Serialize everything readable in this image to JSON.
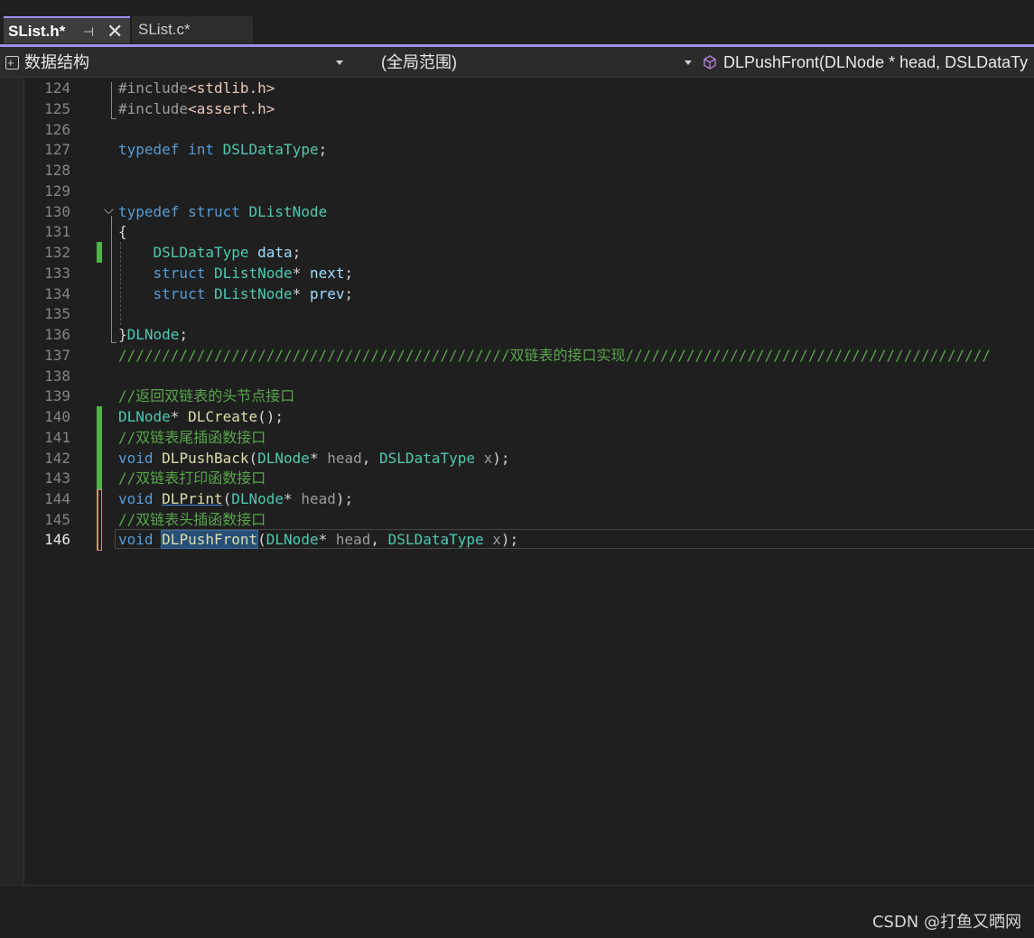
{
  "tabs": {
    "active": "SList.h*",
    "inactive": "SList.c*",
    "pin_glyph": "⊣",
    "close_glyph": "✕"
  },
  "navbar": {
    "project": "数据结构",
    "scope": "(全局范围)",
    "member": "DLPushFront(DLNode * head, DSLDataType x)"
  },
  "colors": {
    "accent": "#9d8ef5",
    "background": "#1f1f1f",
    "keyword": "#569cd6",
    "type": "#4ec9b0",
    "function": "#dcdcaa",
    "comment": "#57a64a",
    "change_saved": "#4fb249",
    "change_unsaved": "#c7a230"
  },
  "editor": {
    "current_line": "146",
    "line_numbers": [
      "124",
      "125",
      "126",
      "127",
      "128",
      "129",
      "130",
      "131",
      "132",
      "133",
      "134",
      "135",
      "136",
      "137",
      "138",
      "139",
      "140",
      "141",
      "142",
      "143",
      "144",
      "145",
      "146"
    ],
    "lines": {
      "l124": {
        "pp": "#include",
        "inc": "<stdlib.h>"
      },
      "l125": {
        "pp": "#include",
        "inc": "<assert.h>"
      },
      "l127": {
        "kw1": "typedef",
        "kw2": "int",
        "ty": "DSLDataType",
        "end": ";"
      },
      "l130": {
        "kw1": "typedef",
        "kw2": "struct",
        "ty": "DListNode"
      },
      "l131": {
        "brace": "{"
      },
      "l132": {
        "ty": "DSLDataType",
        "var": "data",
        "end": ";"
      },
      "l133": {
        "kw": "struct",
        "ty": "DListNode",
        "op": "*",
        "var": "next",
        "end": ";"
      },
      "l134": {
        "kw": "struct",
        "ty": "DListNode",
        "op": "*",
        "var": "prev",
        "end": ";"
      },
      "l136": {
        "brace": "}",
        "ty": "DLNode",
        "end": ";"
      },
      "l137": {
        "cm": "/////////////////////////////////////////////双链表的接口实现//////////////////////////////////////////"
      },
      "l139": {
        "cm": "//返回双链表的头节点接口"
      },
      "l140": {
        "ty": "DLNode",
        "op": "*",
        "fn": "DLCreate",
        "rest": "();"
      },
      "l141": {
        "cm": "//双链表尾插函数接口"
      },
      "l142": {
        "kw": "void",
        "fn": "DLPushBack",
        "open": "(",
        "ty1": "DLNode",
        "op": "*",
        "p1": "head",
        "comma": ",",
        "ty2": "DSLDataType",
        "p2": "x",
        "close": ");"
      },
      "l143": {
        "cm": "//双链表打印函数接口"
      },
      "l144": {
        "kw": "void",
        "fn": "DLPrint",
        "open": "(",
        "ty1": "DLNode",
        "op": "*",
        "p1": "head",
        "close": ");"
      },
      "l145": {
        "cm": "//双链表头插函数接口"
      },
      "l146": {
        "kw": "void",
        "fn": "DLPushFront",
        "open": "(",
        "ty1": "DLNode",
        "op": "*",
        "p1": "head",
        "comma": ",",
        "ty2": "DSLDataType",
        "p2": "x",
        "close": ");"
      }
    },
    "fold_glyph": "⌵"
  },
  "watermark": "CSDN @打鱼又晒网"
}
